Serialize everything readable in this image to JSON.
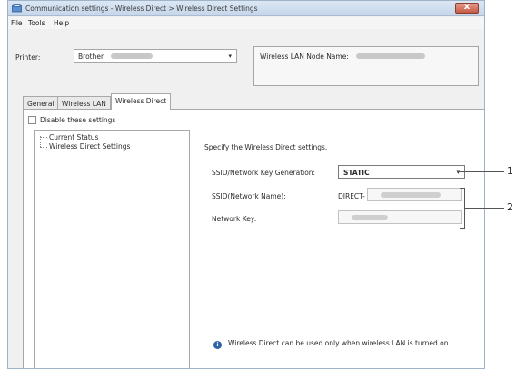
{
  "window": {
    "title": "Communication settings - Wireless Direct > Wireless Direct Settings",
    "close_label": "x"
  },
  "menu": [
    "File",
    "Tools",
    "Help"
  ],
  "printer": {
    "label": "Printer:",
    "value": "Brother"
  },
  "node": {
    "label": "Wireless LAN Node Name:"
  },
  "tabs": [
    {
      "label": "General",
      "active": false
    },
    {
      "label": "Wireless LAN",
      "active": false
    },
    {
      "label": "Wireless Direct",
      "active": true
    }
  ],
  "disable": {
    "label": "Disable these settings",
    "checked": false
  },
  "tree": {
    "items": [
      "Current Status",
      "Wireless Direct Settings"
    ]
  },
  "settings": {
    "description": "Specify the Wireless Direct settings.",
    "key_generation_label": "SSID/Network Key Generation:",
    "key_generation_value": "STATIC",
    "ssid_label": "SSID(Network Name):",
    "ssid_prefix": "DIRECT-",
    "network_key_label": "Network Key:"
  },
  "info": {
    "icon": "info-icon",
    "text": "Wireless Direct can be used only when wireless LAN is turned on."
  },
  "callouts": [
    "1",
    "2"
  ]
}
